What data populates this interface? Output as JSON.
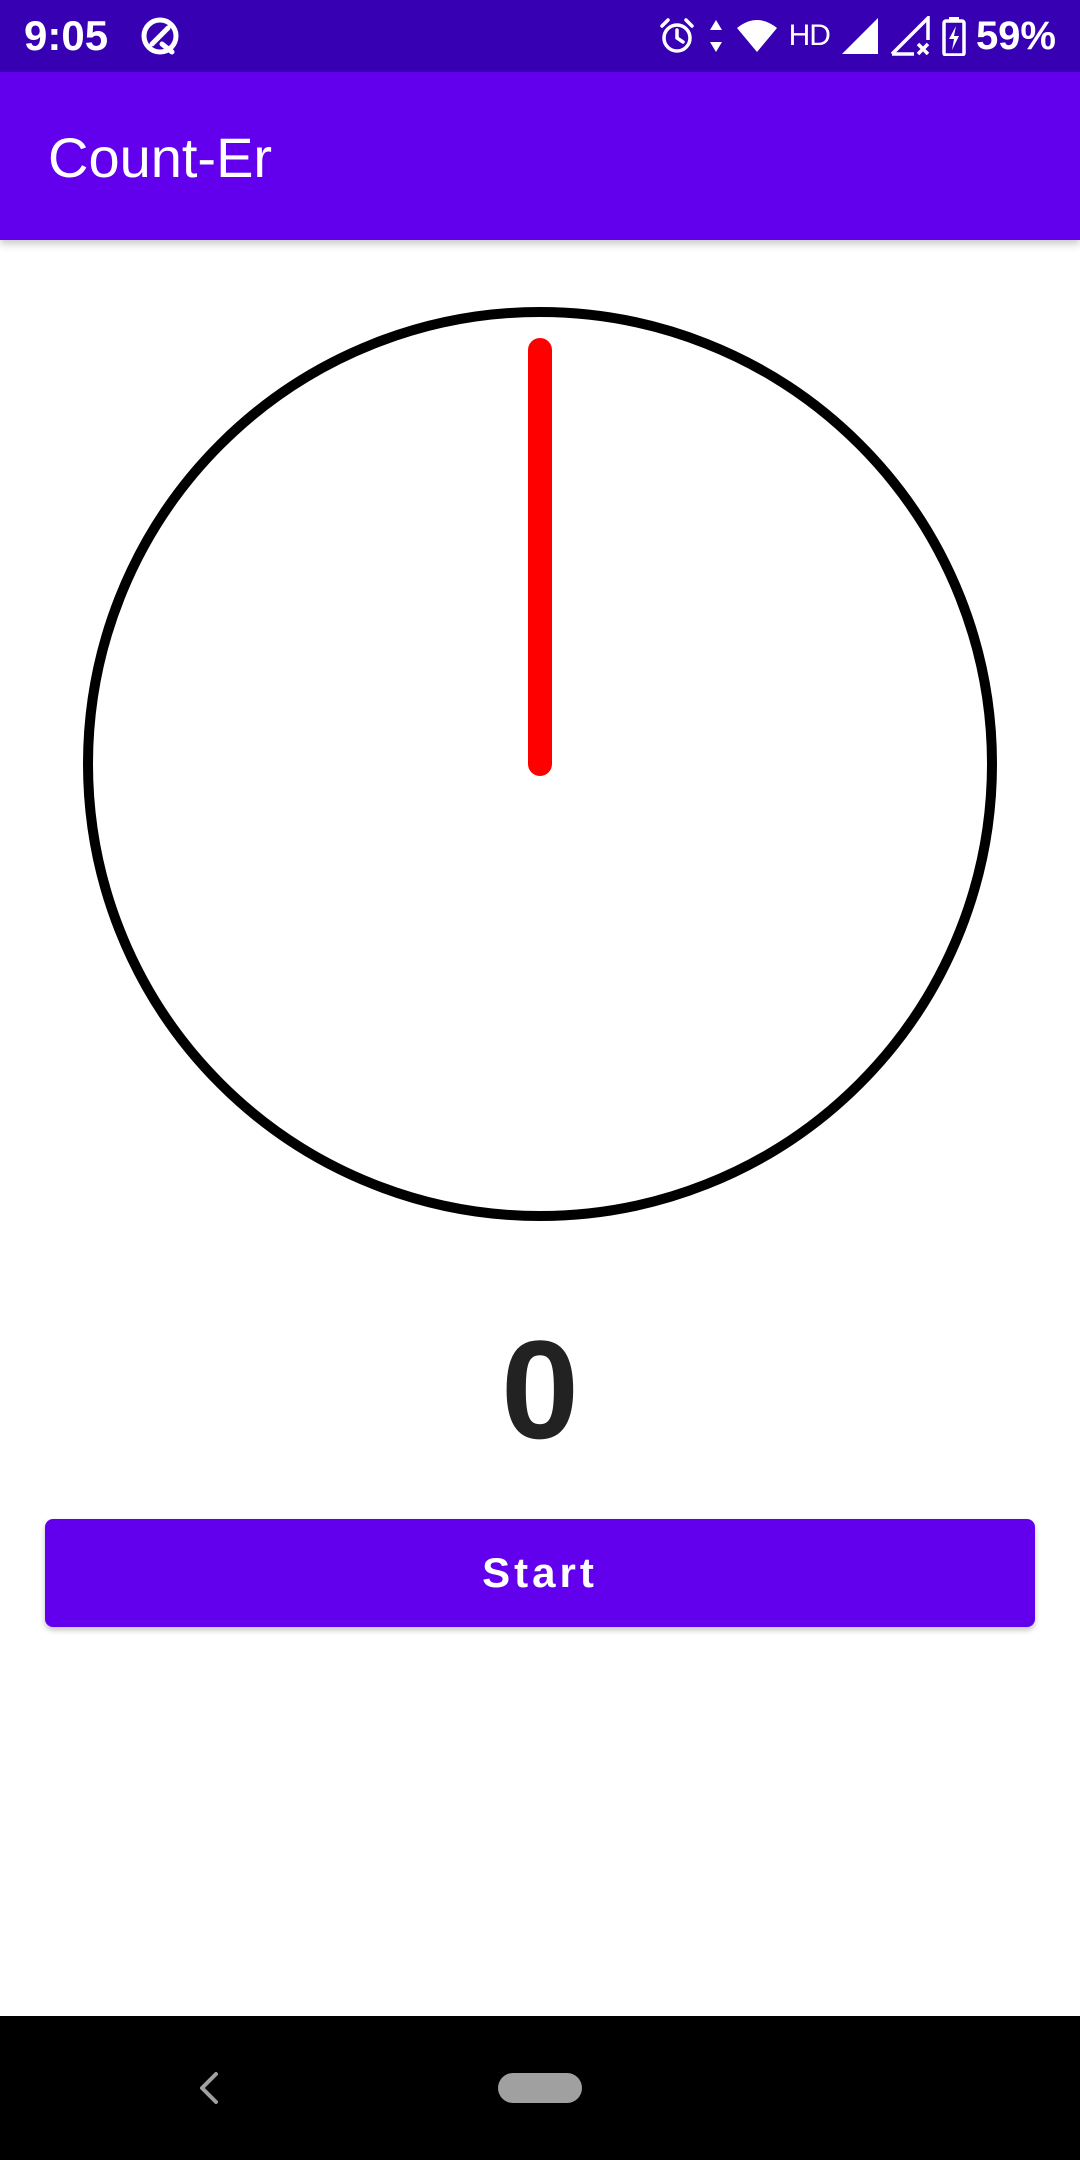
{
  "status_bar": {
    "time": "9:05",
    "network": "HD",
    "battery": "59%",
    "icons": [
      "app-notification-icon",
      "alarm-icon",
      "data-arrows-icon",
      "wifi-icon",
      "signal-icon",
      "signal-no-data-icon",
      "battery-charging-icon"
    ]
  },
  "app_bar": {
    "title": "Count-Er"
  },
  "dial": {
    "hand_angle_degrees": 0,
    "hand_color": "#ff0000",
    "ring_color": "#000000"
  },
  "counter": {
    "value": "0"
  },
  "start_button": {
    "label": "Start"
  },
  "colors": {
    "primary": "#6200ee",
    "primary_dark": "#3700b3",
    "nav_bar": "#000000"
  }
}
